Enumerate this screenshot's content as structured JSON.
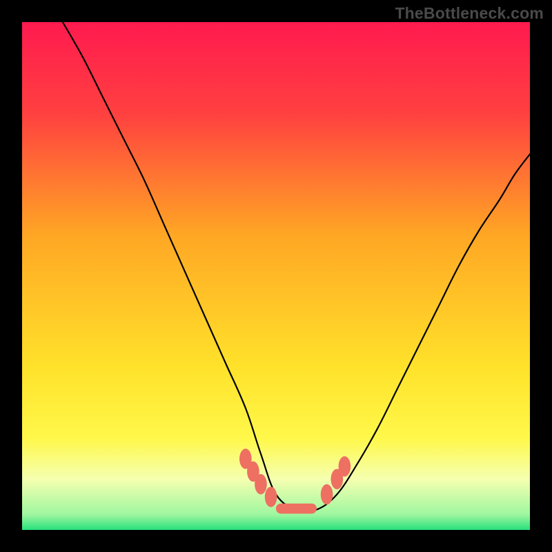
{
  "watermark": "TheBottleneck.com",
  "chart_data": {
    "type": "line",
    "title": "",
    "xlabel": "",
    "ylabel": "",
    "xlim": [
      0,
      100
    ],
    "ylim": [
      0,
      100
    ],
    "grid": false,
    "background_gradient": {
      "stops": [
        {
          "offset": 0.0,
          "color": "#ff1a4f"
        },
        {
          "offset": 0.18,
          "color": "#ff4040"
        },
        {
          "offset": 0.42,
          "color": "#ffa724"
        },
        {
          "offset": 0.68,
          "color": "#ffe22a"
        },
        {
          "offset": 0.82,
          "color": "#fff84a"
        },
        {
          "offset": 0.9,
          "color": "#f5ffb0"
        },
        {
          "offset": 0.97,
          "color": "#9ef7a0"
        },
        {
          "offset": 1.0,
          "color": "#28e07c"
        }
      ]
    },
    "series": [
      {
        "name": "bottleneck-curve",
        "description": "V-shaped bottleneck curve; minimum near x≈50–58 where y≈4; left arm starts at (8,100) with steep descent, right arm rises to (100,74).",
        "x": [
          8,
          12,
          16,
          20,
          24,
          28,
          32,
          36,
          40,
          44,
          47,
          50,
          54,
          58,
          62,
          66,
          70,
          74,
          78,
          82,
          86,
          90,
          94,
          97,
          100
        ],
        "y": [
          100,
          93,
          85,
          77,
          69,
          60,
          51,
          42,
          33,
          24,
          15,
          7,
          4,
          4,
          7,
          13,
          20,
          28,
          36,
          44,
          52,
          59,
          65,
          70,
          74
        ]
      }
    ],
    "markers": {
      "name": "bottom-nodules",
      "description": "Cluster of small salmon capsule/dot markers along the trough of the curve.",
      "color": "#ed7062",
      "points": [
        {
          "x": 44,
          "y": 14,
          "r": 1.6
        },
        {
          "x": 45.5,
          "y": 11.5,
          "r": 1.6
        },
        {
          "x": 47,
          "y": 9,
          "r": 1.6
        },
        {
          "x": 49,
          "y": 6.5,
          "r": 1.6
        },
        {
          "x": 60,
          "y": 7,
          "r": 1.6
        },
        {
          "x": 62,
          "y": 10,
          "r": 1.6
        },
        {
          "x": 63.5,
          "y": 12.5,
          "r": 1.6
        }
      ],
      "bar": {
        "x0": 50,
        "x1": 58,
        "y": 4.2,
        "height": 2.0
      }
    }
  }
}
